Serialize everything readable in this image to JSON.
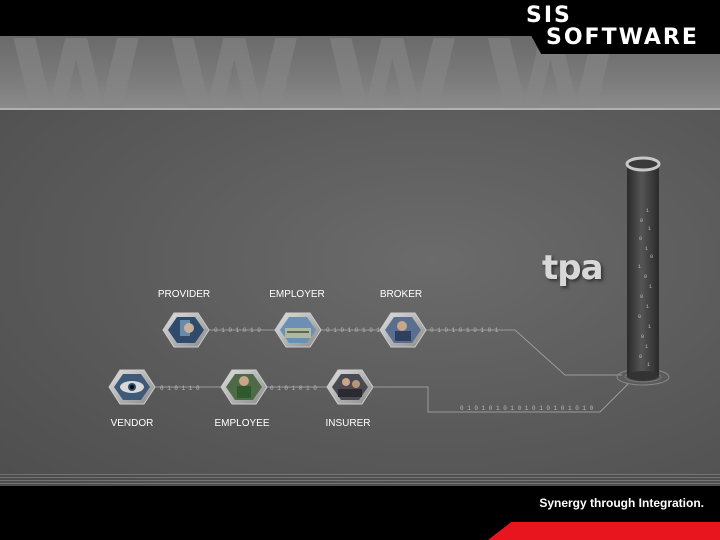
{
  "brand": {
    "line1": "SIS",
    "line2": "SOFTWARE"
  },
  "product_label": "tpa",
  "tagline": "Synergy through Integration.",
  "binary_strings": {
    "row1": "0 1 0 1 0 1 0",
    "row1b": "0 1 0 1 0 1 0 1",
    "row1c": "0 1 0 1 0 1 0 1 0 1",
    "row2": "0 1 0 1 1 0",
    "row2b": "0 1 0 1 0 1 0",
    "row2c": "0 1 0 1 0 1 0 1 0 1 0 1 0 1 0 1 0 1 0"
  },
  "nodes": {
    "provider": {
      "label": "PROVIDER",
      "icon": "monitor-face-icon"
    },
    "employer": {
      "label": "EMPLOYER",
      "icon": "building-icon"
    },
    "broker": {
      "label": "BROKER",
      "icon": "businessman-icon"
    },
    "vendor": {
      "label": "VENDOR",
      "icon": "eye-icon"
    },
    "employee": {
      "label": "EMPLOYEE",
      "icon": "worker-icon"
    },
    "insurer": {
      "label": "INSURER",
      "icon": "meeting-icon"
    }
  },
  "colors": {
    "accent_red": "#e8141e",
    "background": "#5a5a5a",
    "bar": "#000000"
  }
}
